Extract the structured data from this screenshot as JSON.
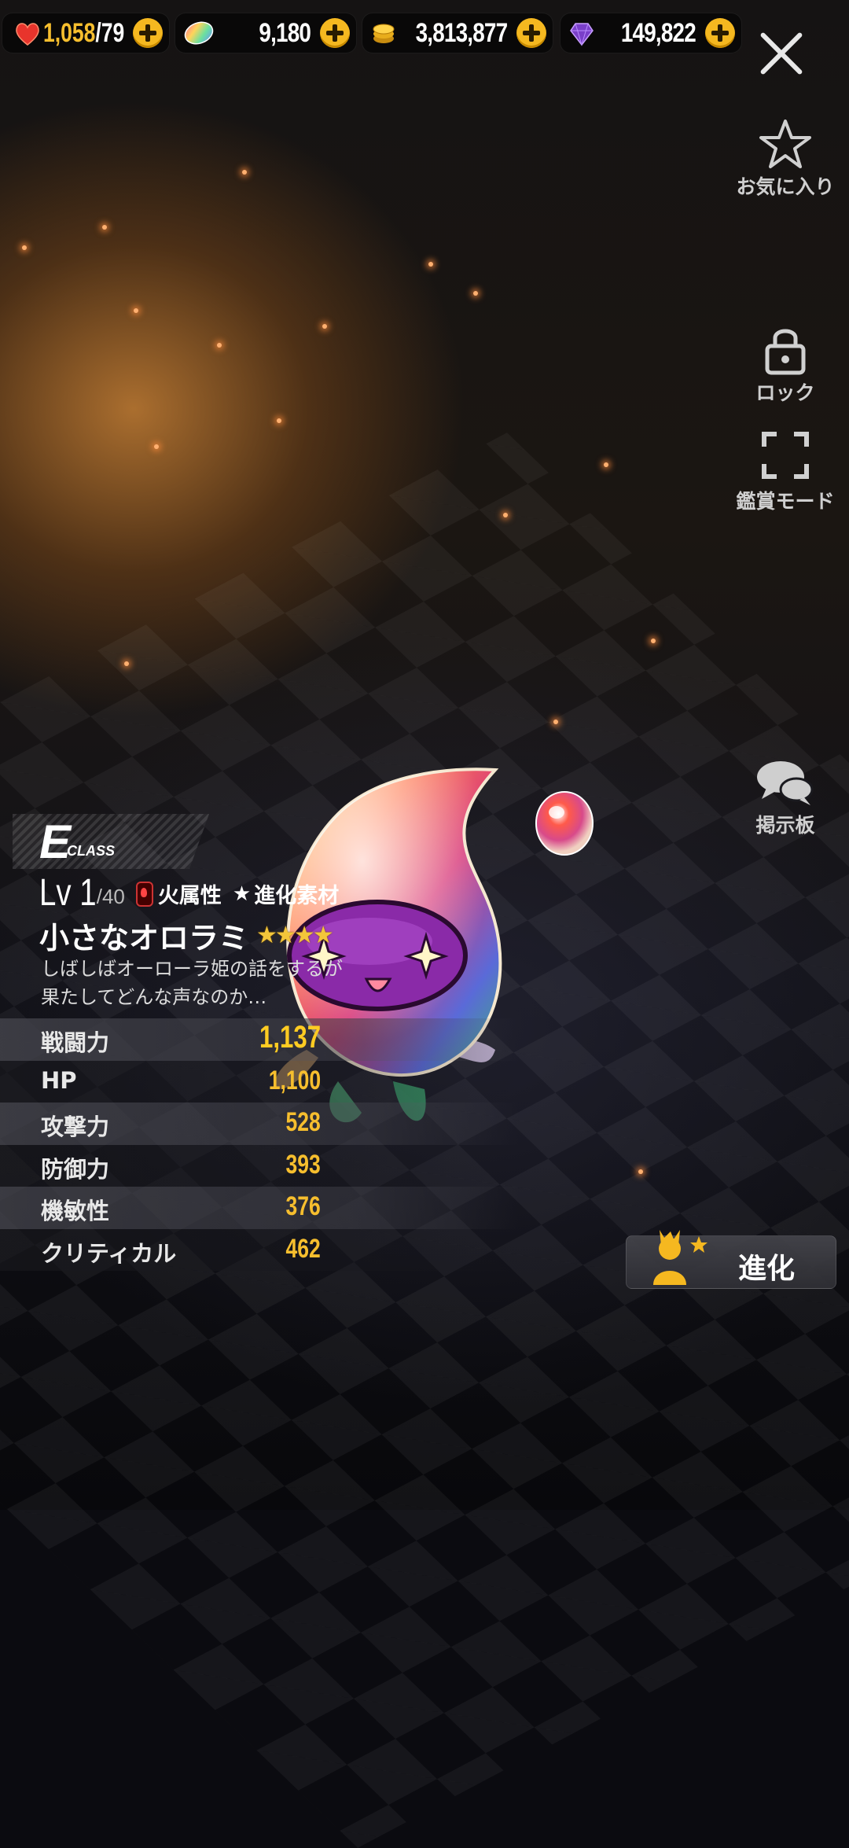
{
  "currencies": [
    {
      "icon": "heart-icon",
      "value": "1,058",
      "max": "/79"
    },
    {
      "icon": "rainbow-gem-icon",
      "value": "9,180"
    },
    {
      "icon": "gold-coin-icon",
      "value": "3,813,877"
    },
    {
      "icon": "purple-gem-icon",
      "value": "149,822"
    }
  ],
  "side_buttons": {
    "favorite": "お気に入り",
    "lock": "ロック",
    "view_mode": "鑑賞モード",
    "board": "掲示板"
  },
  "character": {
    "class_letter": "E",
    "class_word": "CLASS",
    "level": "Lv 1",
    "level_max": "/40",
    "attribute": "火属性",
    "material_tag": "進化素材",
    "name": "小さなオロラミ",
    "stars": "★★★★",
    "rarity_stars": 4,
    "description_lines": [
      "しばしばオーローラ姫の話をするが",
      "果たしてどんな声なのか…"
    ]
  },
  "stats": [
    {
      "label": "戦闘力",
      "value": "1,137"
    },
    {
      "label": "HP",
      "value": "1,100"
    },
    {
      "label": "攻撃力",
      "value": "528"
    },
    {
      "label": "防御力",
      "value": "393"
    },
    {
      "label": "機敏性",
      "value": "376"
    },
    {
      "label": "クリティカル",
      "value": "462"
    }
  ],
  "evolve_button": "進化",
  "colors": {
    "accent_gold": "#f6be2e",
    "plus_button": "#f5b820"
  }
}
